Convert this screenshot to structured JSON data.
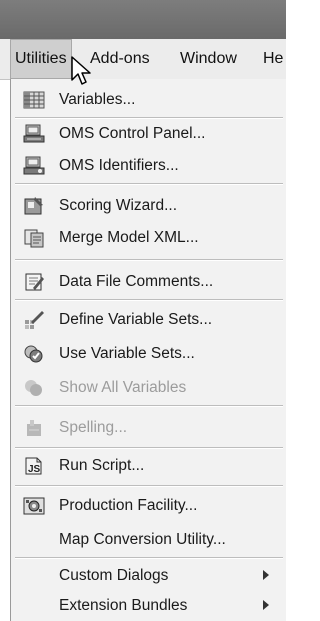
{
  "menubar": {
    "items": [
      {
        "label": "Utilities"
      },
      {
        "label": "Add-ons"
      },
      {
        "label": "Window"
      },
      {
        "label": "He"
      }
    ]
  },
  "menu": {
    "items": [
      {
        "label": "Variables...",
        "icon": "variables-grid-icon",
        "enabled": true
      },
      {
        "label": "OMS Control Panel...",
        "icon": "oms-control-panel-icon",
        "enabled": true
      },
      {
        "label": "OMS Identifiers...",
        "icon": "oms-identifiers-icon",
        "enabled": true
      },
      {
        "label": "Scoring Wizard...",
        "icon": "scoring-wizard-icon",
        "enabled": true
      },
      {
        "label": "Merge Model XML...",
        "icon": "merge-model-xml-icon",
        "enabled": true
      },
      {
        "label": "Data File Comments...",
        "icon": "data-file-comments-icon",
        "enabled": true
      },
      {
        "label": "Define Variable Sets...",
        "icon": "define-variable-sets-icon",
        "enabled": true
      },
      {
        "label": "Use Variable Sets...",
        "icon": "use-variable-sets-icon",
        "enabled": true
      },
      {
        "label": "Show All Variables",
        "icon": "show-all-variables-icon",
        "enabled": false
      },
      {
        "label": "Spelling...",
        "icon": "spelling-icon",
        "enabled": false
      },
      {
        "label": "Run Script...",
        "icon": "run-script-icon",
        "enabled": true
      },
      {
        "label": "Production Facility...",
        "icon": "production-facility-icon",
        "enabled": true
      },
      {
        "label": "Map Conversion Utility...",
        "icon": "",
        "enabled": true
      },
      {
        "label": "Custom Dialogs",
        "icon": "",
        "enabled": true,
        "submenu": true
      },
      {
        "label": "Extension Bundles",
        "icon": "",
        "enabled": true,
        "submenu": true
      }
    ]
  }
}
